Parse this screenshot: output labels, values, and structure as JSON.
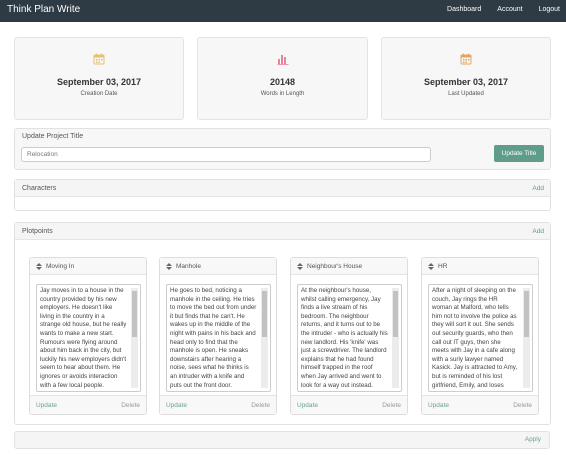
{
  "nav": {
    "brand": "Think Plan Write",
    "links": [
      "Dashboard",
      "Account",
      "Logout"
    ]
  },
  "stats": [
    {
      "value": "September 03, 2017",
      "label": "Creation Date",
      "icon": "calendar-icon",
      "color": "#e8c26a"
    },
    {
      "value": "20148",
      "label": "Words in Length",
      "icon": "bar-chart-icon",
      "color": "#e4839a"
    },
    {
      "value": "September 03, 2017",
      "label": "Last Updated",
      "icon": "calendar-icon",
      "color": "#e8a45e"
    }
  ],
  "project_title": {
    "label": "Update Project Title",
    "placeholder": "Relocation",
    "button": "Update Title"
  },
  "characters": {
    "label": "Characters",
    "add": "Add"
  },
  "plotpoints": {
    "label": "Plotpoints",
    "add": "Add",
    "items": [
      {
        "title": "Moving In",
        "text": "Jay moves in to a house in the country provided by his new employers. He doesn't like living in the country in a strange old house, but he really wants to make a new start. Rumours were flying around about him back in the city, but luckily his new employers didn't seem to hear about them. He ignores or avoids interaction with a few local people.",
        "update": "Update",
        "delete": "Delete"
      },
      {
        "title": "Manhole",
        "text": "He goes to bed, noticing a manhole in the ceiling. He tries to move the bed out from under it but finds that he can't. He wakes up in the middle of the night with pains in his back and head only to find that the manhole is open. He sneaks downstairs after hearing a noise, sees what he thinks is an intruder with a knife and puts out the front door.",
        "update": "Update",
        "delete": "Delete"
      },
      {
        "title": "Neighbour's House",
        "text": "At the neighbour's house, whilst calling emergency, Jay finds a live stream of his bedroom. The neighbour returns, and it turns out to be the intruder - who is actually his new landlord. His 'knife' was just a screwdriver. The landlord explains that he had found himself trapped in the roof when Jay arrived and went to look for a way out instead.",
        "update": "Update",
        "delete": "Delete"
      },
      {
        "title": "HR",
        "text": "After a night of sleeping on the couch, Jay rings the HR woman at Malford, who tells him not to involve the police as they will sort it out. She sends out security guards, who then call out IT guys, then she meets with Jay in a cafe along with a surly lawyer named Kasick. Jay is attracted to Amy, but is reminded of his lost girlfriend, Emily, and loses nerve.",
        "update": "Update",
        "delete": "Delete"
      }
    ]
  },
  "apply": "Apply"
}
